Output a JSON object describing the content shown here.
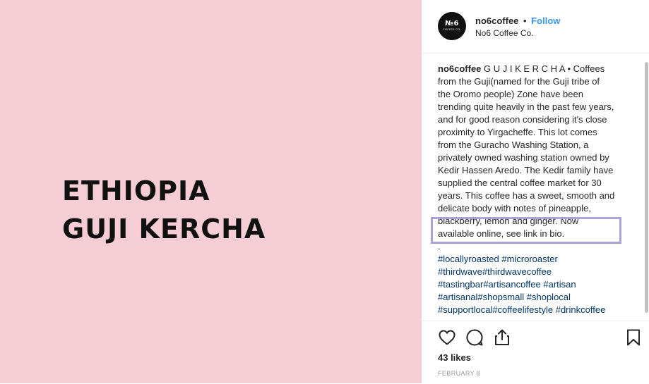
{
  "post_image": {
    "headline_line1": "ETHIOPIA",
    "headline_line2": "GUJI KERCHA",
    "background_color": "#f5cdd4"
  },
  "header": {
    "avatar_logo": "№6",
    "avatar_logo_sub": "COFFEE CO.",
    "username": "no6coffee",
    "separator": "•",
    "follow_label": "Follow",
    "display_name": "No6 Coffee Co."
  },
  "caption": {
    "username": "no6coffee",
    "lines": [
      " G U J I K E R C H A • Coffees",
      "from the Guji(named for the Guji tribe of",
      "the Oromo people) Zone have been",
      "trending quite heavily in the past few years,",
      "and for good reason considering it's close",
      "proximity to Yirgacheffe. This lot comes",
      "from the Guracho Washing Station, a",
      "privately owned washing station owned by",
      "Kedir Hassen Aredo. The Kedir family have",
      "supplied the central coffee market for 30",
      "years. This coffee has a sweet, smooth and",
      "delicate body with notes of pineapple,",
      "blackberry, lemon and ginger. Now",
      "available online, see link in bio.",
      "."
    ],
    "hashtag_lines": [
      [
        "#locallyroasted",
        " ",
        "#microroaster"
      ],
      [
        "#thirdwave",
        "",
        "#thirdwavecoffee"
      ],
      [
        "#tastingbar",
        "",
        "#artisancoffee",
        " ",
        "#artisan"
      ],
      [
        "#artisanal",
        "",
        "#shopsmall",
        " ",
        "#shoplocal"
      ],
      [
        "#supportlocal",
        "",
        "#coffeelifestyle",
        " ",
        "#drinkcoffee"
      ]
    ]
  },
  "actions": {
    "icons": [
      "heart-icon",
      "comment-icon",
      "share-icon",
      "bookmark-icon"
    ],
    "likes_text": "43 likes",
    "date_text": "FEBRUARY 8"
  },
  "colors": {
    "follow": "#3897f0",
    "hashtag": "#003569",
    "highlight_box": "#a9a3d9"
  }
}
